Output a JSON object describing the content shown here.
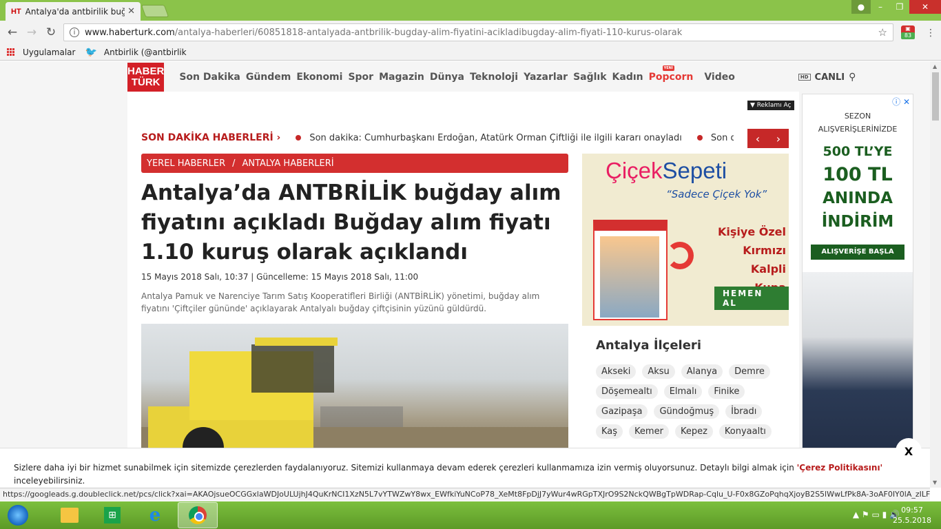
{
  "browser": {
    "tab_title": "Antalya'da antbirilik buğd",
    "tab_favicon": "HT",
    "url_host": "www.haberturk.com",
    "url_path": "/antalya-haberleri/60851818-antalyada-antbrilik-bugday-alim-fiyatini-acikladibugday-alim-fiyati-110-kurus-olarak",
    "extension_badge": "83",
    "bookmarks": [
      "Uygulamalar",
      "Antbirlik (@antbirlik"
    ]
  },
  "site": {
    "logo_line1": "HABER",
    "logo_line2": "TÜRK",
    "nav": [
      "Son Dakika",
      "Gündem",
      "Ekonomi",
      "Spor",
      "Magazin",
      "Dünya",
      "Teknoloji",
      "Yazarlar",
      "Sağlık",
      "Kadın",
      "Popcorn",
      "Video"
    ],
    "nav_new_badge": "YENİ",
    "hd_label": "HD",
    "live_label": "CANLI",
    "ad_label": "Reklamı Aç"
  },
  "breaking": {
    "label": "SON DAKİKA HABERLERİ",
    "items": [
      "Son dakika: Cumhurbaşkanı Erdoğan, Atatürk Orman Çiftliği ile ilgili kararı onayladı",
      "Son dakika"
    ]
  },
  "article": {
    "breadcrumb": [
      "YEREL HABERLER",
      "ANTALYA HABERLERİ"
    ],
    "title": "Antalya’da ANTBRİLİK buğday alım fiyatını açıkladı Buğday alım fiyatı 1.10 kuruş olarak açıklandı",
    "dates": "15 Mayıs 2018 Salı, 10:37 | Güncelleme: 15 Mayıs 2018 Salı, 11:00",
    "summary": "Antalya Pamuk ve Narenciye Tarım Satış Kooperatifleri Birliği (ANTBİRLİK) yönetimi, buğday alım fiyatını 'Çiftçiler gününde' açıklayarak Antalyalı buğday çiftçisinin yüzünü güldürdü."
  },
  "ad_cicek": {
    "brand_a": "Çiçek",
    "brand_b": "Sepeti",
    "slogan": "“Sadece Çiçek Yok”",
    "promo": [
      "Kişiye Özel",
      "Kırmızı Kalpli",
      "Kupa Bardak"
    ],
    "button": "HEMEN AL"
  },
  "districts": {
    "title": "Antalya İlçeleri",
    "items": [
      "Akseki",
      "Aksu",
      "Alanya",
      "Demre",
      "Döşemealtı",
      "Elmalı",
      "Finike",
      "Gazipaşa",
      "Gündoğmuş",
      "İbradı",
      "Kaş",
      "Kemer",
      "Kepez",
      "Konyaaltı"
    ]
  },
  "ad_side": {
    "line1": "SEZON",
    "line2": "ALIŞVERİŞLERİNİZDE",
    "big1": "500 TL’YE",
    "big2": "100 TL",
    "big3": "ANINDA",
    "big4": "İNDİRİM",
    "button": "ALIŞVERİŞE BAŞLA"
  },
  "cookie": {
    "text": "Sizlere daha iyi bir hizmet sunabilmek için sitemizde çerezlerden faydalanıyoruz. Sitemizi kullanmaya devam ederek çerezleri kullanmamıza izin vermiş oluyorsunuz. Detaylı bilgi almak için ",
    "link": "'Çerez Politikasını'",
    "tail": "inceleyebilirsiniz.",
    "close": "X"
  },
  "status_url": "https://googleads.g.doubleclick.net/pcs/click?xai=AKAOjsueOCGGxlaWDJoULUjhJ4QuKrNCI1XzN5L7vYTWZwY8wx_EWfkiYuNCoP78_XeMt8FpDjJ7yWur4wRGpTXJrO9S2NckQWBgTpWDRap-Cqlu_U-F0x8GZoPqhqXjoyB2S5lWwLfPk8A-3oAF0IY0lA_zILFrm...",
  "taskbar": {
    "time": "09:57",
    "date": "25.5.2018"
  }
}
